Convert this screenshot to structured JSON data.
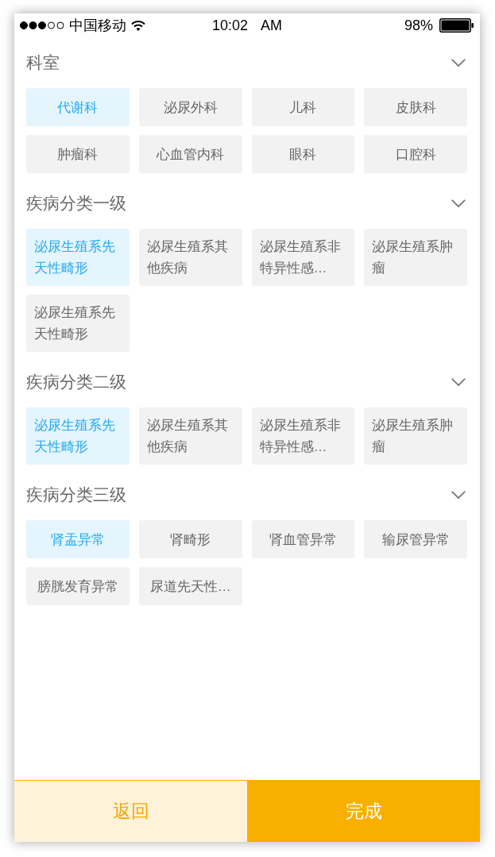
{
  "status_bar": {
    "carrier": "中国移动",
    "time": "10:02 AM",
    "battery": "98%"
  },
  "sections": [
    {
      "title": "科室",
      "tags": [
        {
          "label": "代谢科",
          "selected": true
        },
        {
          "label": "泌尿外科",
          "selected": false
        },
        {
          "label": "儿科",
          "selected": false
        },
        {
          "label": "皮肤科",
          "selected": false
        },
        {
          "label": "肿瘤科",
          "selected": false
        },
        {
          "label": "心血管内科",
          "selected": false
        },
        {
          "label": "眼科",
          "selected": false
        },
        {
          "label": "口腔科",
          "selected": false
        }
      ]
    },
    {
      "title": "疾病分类一级",
      "tags": [
        {
          "label": "泌尿生殖系先天性畸形",
          "selected": true
        },
        {
          "label": "泌尿生殖系其他疾病",
          "selected": false
        },
        {
          "label": "泌尿生殖系非特异性感…",
          "selected": false
        },
        {
          "label": "泌尿生殖系肿瘤",
          "selected": false
        },
        {
          "label": "泌尿生殖系先天性畸形",
          "selected": false
        }
      ]
    },
    {
      "title": "疾病分类二级",
      "tags": [
        {
          "label": "泌尿生殖系先天性畸形",
          "selected": true
        },
        {
          "label": "泌尿生殖系其他疾病",
          "selected": false
        },
        {
          "label": "泌尿生殖系非特异性感…",
          "selected": false
        },
        {
          "label": "泌尿生殖系肿瘤",
          "selected": false
        }
      ]
    },
    {
      "title": "疾病分类三级",
      "tags": [
        {
          "label": "肾盂异常",
          "selected": true
        },
        {
          "label": "肾畸形",
          "selected": false
        },
        {
          "label": "肾血管异常",
          "selected": false
        },
        {
          "label": "输尿管异常",
          "selected": false
        },
        {
          "label": "膀胱发育异常",
          "selected": false
        },
        {
          "label": "尿道先天性…",
          "selected": false
        }
      ]
    }
  ],
  "buttons": [
    {
      "label": "返回",
      "kind": "secondary"
    },
    {
      "label": "完成",
      "kind": "primary"
    }
  ]
}
